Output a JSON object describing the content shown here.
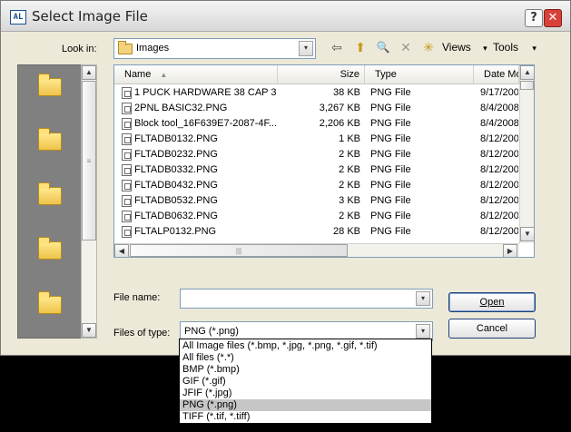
{
  "window": {
    "title": "Select Image File",
    "app_icon_text": "AL",
    "help_glyph": "?",
    "close_glyph": "✕"
  },
  "look_in": {
    "label": "Look in:",
    "value": "Images"
  },
  "toolbar": {
    "back_glyph": "⇦",
    "up_glyph": "⬆",
    "search_glyph": "🔍",
    "delete_glyph": "✕",
    "new_folder_glyph": "✳",
    "views_label": "Views",
    "tools_label": "Tools",
    "dropdown_glyph": "▾"
  },
  "places_bar": {
    "count": 5
  },
  "file_list": {
    "columns": [
      "Name",
      "Size",
      "Type",
      "Date Mo"
    ],
    "rows": [
      {
        "name": "1 PUCK HARDWARE 38 CAP 3...",
        "size": "38 KB",
        "type": "PNG File",
        "date": "9/17/200"
      },
      {
        "name": "2PNL BASIC32.PNG",
        "size": "3,267 KB",
        "type": "PNG File",
        "date": "8/4/2008"
      },
      {
        "name": "Block tool_16F639E7-2087-4F...",
        "size": "2,206 KB",
        "type": "PNG File",
        "date": "8/4/2008"
      },
      {
        "name": "FLTADB0132.PNG",
        "size": "1 KB",
        "type": "PNG File",
        "date": "8/12/200"
      },
      {
        "name": "FLTADB0232.PNG",
        "size": "2 KB",
        "type": "PNG File",
        "date": "8/12/200"
      },
      {
        "name": "FLTADB0332.PNG",
        "size": "2 KB",
        "type": "PNG File",
        "date": "8/12/200"
      },
      {
        "name": "FLTADB0432.PNG",
        "size": "2 KB",
        "type": "PNG File",
        "date": "8/12/200"
      },
      {
        "name": "FLTADB0532.PNG",
        "size": "3 KB",
        "type": "PNG File",
        "date": "8/12/200"
      },
      {
        "name": "FLTADB0632.PNG",
        "size": "2 KB",
        "type": "PNG File",
        "date": "8/12/200"
      },
      {
        "name": "FLTALP0132.PNG",
        "size": "28 KB",
        "type": "PNG File",
        "date": "8/12/200"
      }
    ]
  },
  "file_name": {
    "label": "File name:",
    "value": ""
  },
  "files_of_type": {
    "label": "Files of type:",
    "value": "PNG (*.png)",
    "options": [
      "All Image files (*.bmp, *.jpg, *.png, *.gif, *.tif)",
      "All files (*.*)",
      "BMP (*.bmp)",
      "GIF (*.gif)",
      "JFIF (*.jpg)",
      "PNG (*.png)",
      "TIFF (*.tif, *.tiff)"
    ],
    "selected_index": 5
  },
  "buttons": {
    "open": "Open",
    "cancel": "Cancel"
  },
  "scroll": {
    "up": "▲",
    "down": "▼",
    "left": "◀",
    "right": "▶",
    "grip_v": "≡",
    "grip_h": "|||"
  }
}
